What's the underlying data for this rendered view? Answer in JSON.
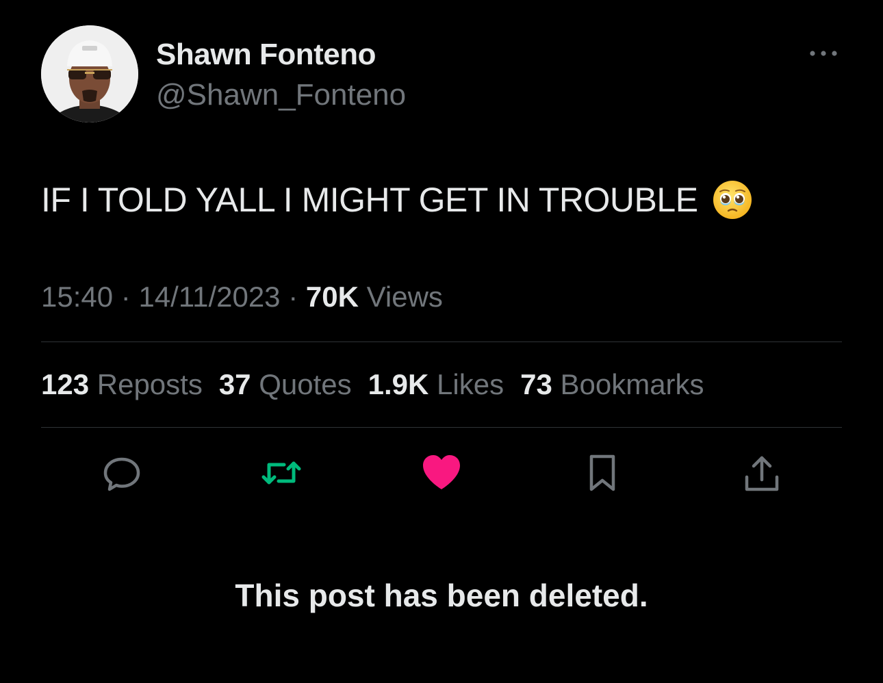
{
  "author": {
    "display_name": "Shawn Fonteno",
    "handle": "@Shawn_Fonteno"
  },
  "post": {
    "text": "IF I TOLD YALL I MIGHT GET IN TROUBLE",
    "emoji": "face-holding-back-tears",
    "time": "15:40",
    "date": "14/11/2023",
    "separator": "·",
    "views_count": "70K",
    "views_label": "Views"
  },
  "stats": [
    {
      "count": "123",
      "label": "Reposts"
    },
    {
      "count": "37",
      "label": "Quotes"
    },
    {
      "count": "1.9K",
      "label": "Likes"
    },
    {
      "count": "73",
      "label": "Bookmarks"
    }
  ],
  "actions": [
    {
      "icon": "reply-icon"
    },
    {
      "icon": "repost-icon",
      "color": "#00ba7c"
    },
    {
      "icon": "like-icon",
      "color": "#f91880",
      "active": true
    },
    {
      "icon": "bookmark-icon"
    },
    {
      "icon": "share-icon"
    }
  ],
  "notice": "This post has been deleted.",
  "colors": {
    "background": "#000000",
    "primary_text": "#e7e9ea",
    "secondary_text": "#71767b",
    "divider": "#2f3336",
    "repost": "#00ba7c",
    "like": "#f91880"
  }
}
